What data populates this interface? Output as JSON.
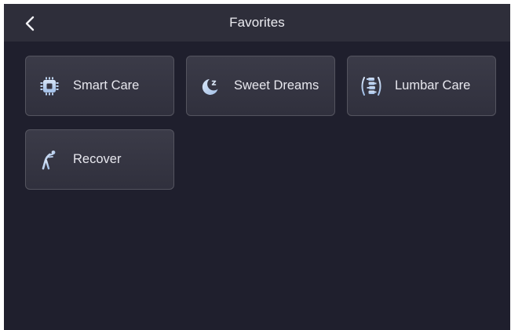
{
  "header": {
    "title": "Favorites",
    "back_icon": "chevron-left-icon"
  },
  "favorites": [
    {
      "label": "Smart Care",
      "icon": "chip-icon"
    },
    {
      "label": "Sweet Dreams",
      "icon": "moon-sleep-icon"
    },
    {
      "label": "Lumbar Care",
      "icon": "spine-icon"
    },
    {
      "label": "Recover",
      "icon": "stretch-figure-icon"
    }
  ],
  "colors": {
    "background": "#1f1f2d",
    "header": "#2e2e3a",
    "tile": "#363643",
    "tile_border": "#54545f",
    "icon_accent": "#bcd2f2",
    "text": "#e7e7ee"
  }
}
